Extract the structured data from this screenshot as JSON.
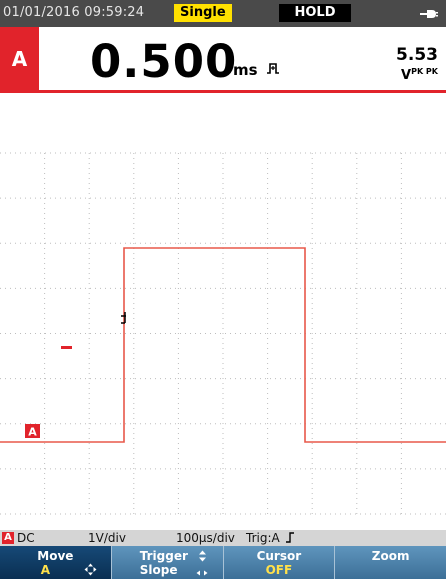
{
  "status": {
    "datetime": "01/01/2016 09:59:24",
    "mode": "Single",
    "hold": "HOLD",
    "power_icon": "mains-plug-icon"
  },
  "reading": {
    "channel": "A",
    "value": "0.500",
    "unit": "ms",
    "pulse_icon": "pulse-width-icon",
    "secondary_value": "5.53",
    "secondary_unit": "V",
    "secondary_qualifier": "PK PK"
  },
  "graph": {
    "channel_marker": "A",
    "colors": {
      "trace": "#e8584a",
      "grid": "#bdbdbd",
      "channel": "#e1232b"
    }
  },
  "scale": {
    "channel": "A",
    "coupling": "DC",
    "volts_per_div": "1V/div",
    "time_per_div": "100µs/div",
    "trigger": "Trig:A"
  },
  "softkeys": [
    {
      "label": "Move",
      "sub": "A",
      "icon": "move-arrows-icon",
      "active": true
    },
    {
      "label": "Trigger",
      "sub": "Slope",
      "icon": "up-down-arrows-icon"
    },
    {
      "label": "Cursor",
      "sub": "OFF"
    },
    {
      "label": "Zoom",
      "sub": ""
    }
  ]
}
